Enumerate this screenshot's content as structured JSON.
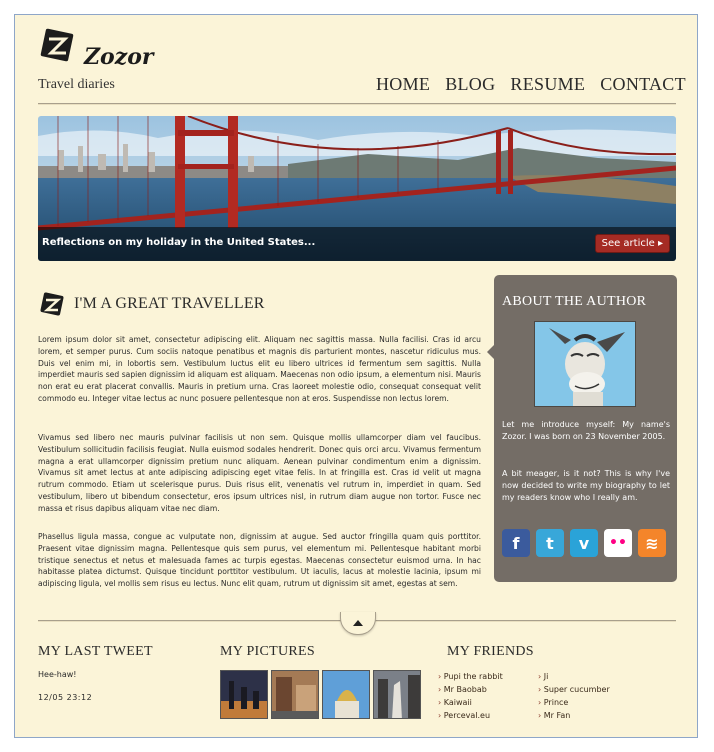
{
  "brand": {
    "name": "Zozor",
    "tagline": "Travel diaries"
  },
  "nav": [
    "HOME",
    "BLOG",
    "RESUME",
    "CONTACT"
  ],
  "banner": {
    "caption": "Reflections on my holiday in the United States...",
    "button": "See article ▸"
  },
  "main": {
    "title": "I'M A GREAT TRAVELLER",
    "paragraphs": [
      "Lorem ipsum dolor sit amet, consectetur adipiscing elit. Aliquam nec sagittis massa. Nulla facilisi. Cras id arcu lorem, et semper purus. Cum sociis natoque penatibus et magnis dis parturient montes, nascetur ridiculus mus. Duis vel enim mi, in lobortis sem. Vestibulum luctus elit eu libero ultrices id fermentum sem sagittis. Nulla imperdiet mauris sed sapien dignissim id aliquam est aliquam. Maecenas non odio ipsum, a elementum nisi. Mauris non erat eu erat placerat convallis. Mauris in pretium urna. Cras laoreet molestie odio, consequat consequat velit commodo eu. Integer vitae lectus ac nunc posuere pellentesque non at eros. Suspendisse non lectus lorem.",
      "Vivamus sed libero nec mauris pulvinar facilisis ut non sem. Quisque mollis ullamcorper diam vel faucibus. Vestibulum sollicitudin facilisis feugiat. Nulla euismod sodales hendrerit. Donec quis orci arcu. Vivamus fermentum magna a erat ullamcorper dignissim pretium nunc aliquam. Aenean pulvinar condimentum enim a dignissim. Vivamus sit amet lectus at ante adipiscing adipiscing eget vitae felis. In at fringilla est. Cras id velit ut magna rutrum commodo. Etiam ut scelerisque purus. Duis risus elit, venenatis vel rutrum in, imperdiet in quam. Sed vestibulum, libero ut bibendum consectetur, eros ipsum ultrices nisl, in rutrum diam augue non tortor. Fusce nec massa et risus dapibus aliquam vitae nec diam.",
      "Phasellus ligula massa, congue ac vulputate non, dignissim at augue. Sed auctor fringilla quam quis porttitor. Praesent vitae dignissim magna. Pellentesque quis sem purus, vel elementum mi. Pellentesque habitant morbi tristique senectus et netus et malesuada fames ac turpis egestas. Maecenas consectetur euismod urna. In hac habitasse platea dictumst. Quisque tincidunt porttitor vestibulum. Ut iaculis, lacus at molestie lacinia, ipsum mi adipiscing ligula, vel mollis sem risus eu lectus. Nunc elit quam, rutrum ut dignissim sit amet, egestas at sem."
    ]
  },
  "about": {
    "title": "ABOUT THE AUTHOR",
    "intro": "Let me introduce myself: My name's Zozor. I was born on 23 November 2005.",
    "bio": "A bit meager, is it not? This is why I've now decided to write my biography to let my readers know who I really am.",
    "social": [
      {
        "icon": "facebook-icon",
        "glyph": "f",
        "color": "#3b5b9d"
      },
      {
        "icon": "twitter-icon",
        "glyph": "t",
        "color": "#38a7d9"
      },
      {
        "icon": "vimeo-icon",
        "glyph": "v",
        "color": "#2aa3d8"
      },
      {
        "icon": "flickr-icon",
        "glyph": "••",
        "color": "#ffffff"
      },
      {
        "icon": "rss-icon",
        "glyph": "≋",
        "color": "#f4852a"
      }
    ]
  },
  "footer": {
    "tweet_title": "MY LAST TWEET",
    "tweet_text": "Hee-haw!",
    "tweet_date": "12/05 23:12",
    "pictures_title": "MY PICTURES",
    "friends_title": "MY FRIENDS",
    "friends_col1": [
      "Pupi the rabbit",
      "Mr Baobab",
      "Kaiwaii",
      "Perceval.eu"
    ],
    "friends_col2": [
      "Ji",
      "Super cucumber",
      "Prince",
      "Mr Fan"
    ]
  }
}
